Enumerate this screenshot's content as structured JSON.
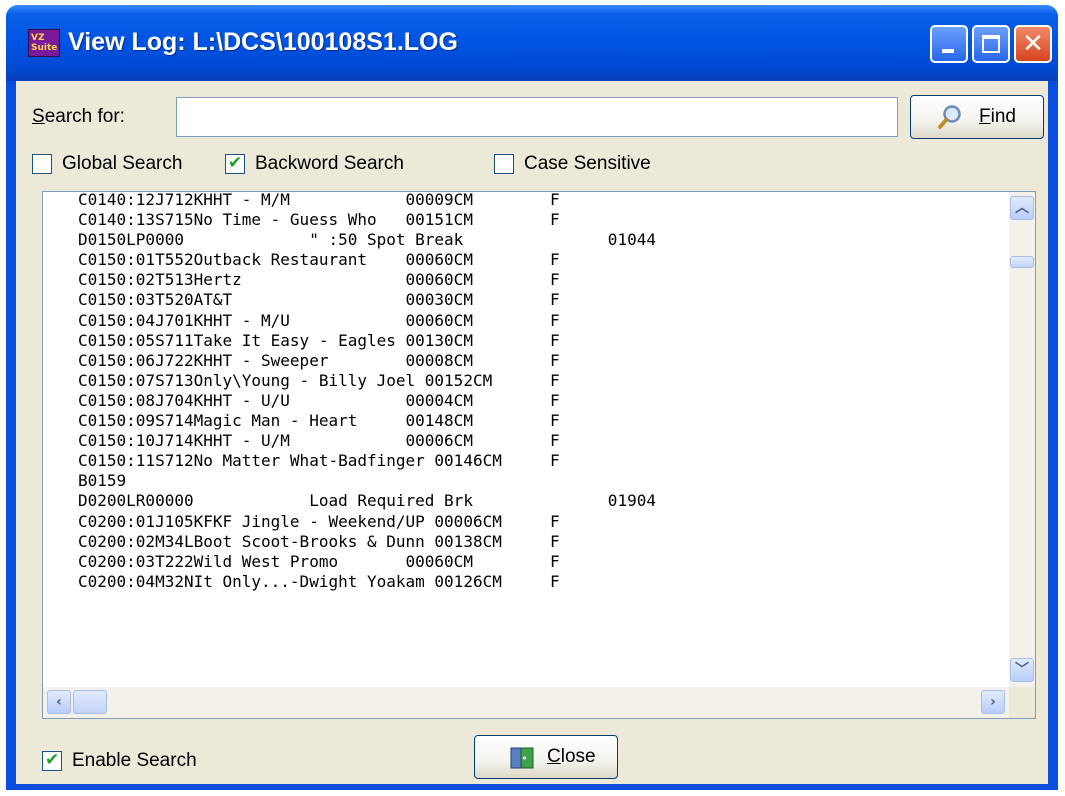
{
  "window": {
    "title": "View Log: L:\\DCS\\100108S1.LOG",
    "app_icon_text": "VZ\nSuite",
    "buttons": {
      "minimize": "minimize",
      "maximize": "maximize",
      "close_glyph": "✕"
    }
  },
  "search": {
    "label_prefix": "",
    "label_mnemonic": "S",
    "label_rest": "earch for:",
    "value": "",
    "find_button": {
      "mnemonic": "F",
      "rest": "ind",
      "icon": "magnifier-icon"
    }
  },
  "options": [
    {
      "label": "Global Search",
      "checked": false
    },
    {
      "label": "Backword Search",
      "checked": true
    },
    {
      "label": "Case Sensitive",
      "checked": false
    }
  ],
  "log": {
    "lines": [
      "C0140:12J712KHHT - M/M            00009CM        F",
      "C0140:13S715No Time - Guess Who   00151CM        F",
      "D0150LP0000             \" :50 Spot Break               01044",
      "C0150:01T552Outback Restaurant    00060CM        F",
      "C0150:02T513Hertz                 00060CM        F",
      "C0150:03T520AT&T                  00030CM        F",
      "C0150:04J701KHHT - M/U            00060CM        F",
      "C0150:05S711Take It Easy - Eagles 00130CM        F",
      "C0150:06J722KHHT - Sweeper        00008CM        F",
      "C0150:07S713Only\\Young - Billy Joel 00152CM      F",
      "C0150:08J704KHHT - U/U            00004CM        F",
      "C0150:09S714Magic Man - Heart     00148CM        F",
      "C0150:10J714KHHT - U/M            00006CM        F",
      "C0150:11S712No Matter What-Badfinger 00146CM     F",
      "B0159",
      "D0200LR00000            Load Required Brk              01904",
      "C0200:01J105KFKF Jingle - Weekend/UP 00006CM     F",
      "C0200:02M34LBoot Scoot-Brooks & Dunn 00138CM     F",
      "C0200:03T222Wild West Promo       00060CM        F",
      "C0200:04M32NIt Only...-Dwight Yoakam 00126CM     F"
    ]
  },
  "enable_search": {
    "label": "Enable Search",
    "checked": true
  },
  "close_button": {
    "mnemonic": "C",
    "rest": "lose",
    "icon": "door-exit-icon"
  }
}
